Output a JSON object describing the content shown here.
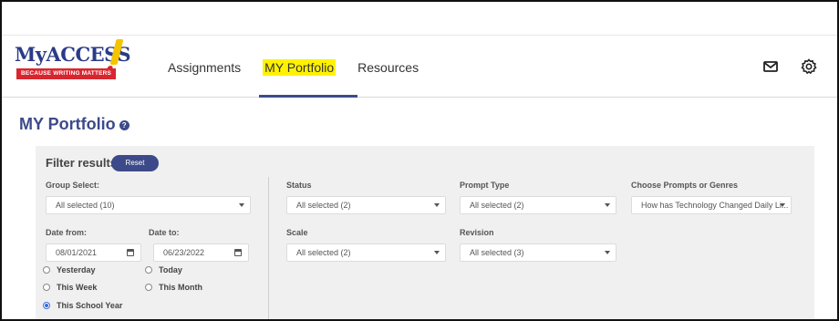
{
  "logo": {
    "word": "MyACCESS",
    "tagline": "BECAUSE WRITING MATTERS"
  },
  "nav": {
    "tabs": [
      {
        "label": "Assignments",
        "active": false
      },
      {
        "label": "MY Portfolio",
        "active": true
      },
      {
        "label": "Resources",
        "active": false
      }
    ]
  },
  "header_icons": [
    "mail-icon",
    "gear-icon"
  ],
  "page": {
    "title": "MY Portfolio",
    "help_icon": "help-icon"
  },
  "filter": {
    "title": "Filter results",
    "reset_label": "Reset",
    "group_select": {
      "label": "Group Select:",
      "value": "All selected (10)"
    },
    "date_from": {
      "label": "Date from:",
      "value": "08/01/2021"
    },
    "date_to": {
      "label": "Date to:",
      "value": "06/23/2022"
    },
    "date_ranges": [
      {
        "label": "Yesterday",
        "selected": false
      },
      {
        "label": "Today",
        "selected": false
      },
      {
        "label": "This Week",
        "selected": false
      },
      {
        "label": "This Month",
        "selected": false
      },
      {
        "label": "This School Year",
        "selected": true
      }
    ],
    "status": {
      "label": "Status",
      "value": "All selected (2)"
    },
    "prompt_type": {
      "label": "Prompt Type",
      "value": "All selected (2)"
    },
    "prompts_genres": {
      "label": "Choose Prompts or Genres",
      "value": "How has Technology Changed Daily Li..."
    },
    "scale": {
      "label": "Scale",
      "value": "All selected (2)"
    },
    "revision": {
      "label": "Revision",
      "value": "All selected (3)"
    }
  },
  "colors": {
    "brand": "#3c4a8a",
    "highlight": "#fff200",
    "logo_red": "#d8262f",
    "panel_bg": "#f0f0f0"
  }
}
